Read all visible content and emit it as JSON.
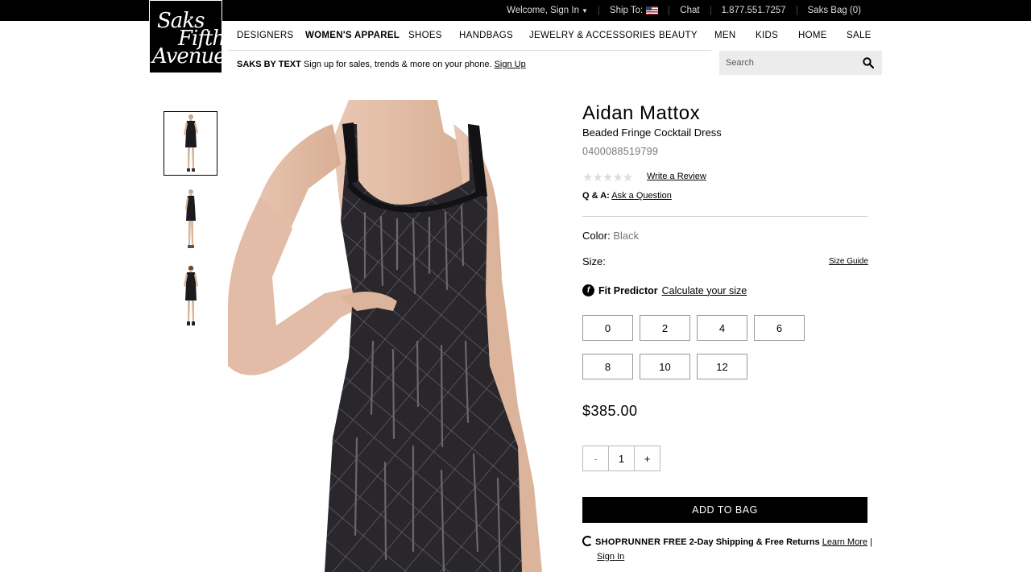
{
  "topbar": {
    "welcome": "Welcome, Sign In",
    "ship_to": "Ship To:",
    "chat": "Chat",
    "phone": "1.877.551.7257",
    "bag": "Saks Bag (0)"
  },
  "logo": {
    "line1": "Saks",
    "line2": "Fifth",
    "line3": "Avenue"
  },
  "nav": {
    "items": [
      {
        "label": "DESIGNERS"
      },
      {
        "label": "WOMEN'S APPAREL"
      },
      {
        "label": "SHOES"
      },
      {
        "label": "HANDBAGS"
      },
      {
        "label": "JEWELRY & ACCESSORIES"
      },
      {
        "label": "BEAUTY"
      },
      {
        "label": "MEN"
      },
      {
        "label": "KIDS"
      },
      {
        "label": "HOME"
      },
      {
        "label": "SALE"
      }
    ]
  },
  "promo": {
    "title": "SAKS BY TEXT",
    "text": "Sign up for sales, trends & more on your phone.",
    "link": "Sign Up"
  },
  "search": {
    "placeholder": "Search"
  },
  "product": {
    "brand": "Aidan Mattox",
    "name": "Beaded Fringe Cocktail Dress",
    "sku": "0400088519799",
    "rating_stars": "★★★★★",
    "write_review": "Write a Review",
    "qa_label": "Q & A:",
    "ask_question": "Ask a Question",
    "color_label": "Color:",
    "color_value": "Black",
    "size_label": "Size:",
    "size_guide": "Size Guide",
    "fit_icon": "f",
    "fit_label": "Fit Predictor",
    "fit_link": "Calculate your size",
    "sizes": [
      "0",
      "2",
      "4",
      "6",
      "8",
      "10",
      "12"
    ],
    "price": "$385.00",
    "qty_minus": "-",
    "qty_value": "1",
    "qty_plus": "+",
    "add_to_bag": "ADD TO BAG",
    "shoprunner_logo": "SHOPRUNNER",
    "shoprunner_free": "FREE 2-Day Shipping & Free Returns",
    "learn_more": "Learn More",
    "separator": "|",
    "sign_in": "Sign In"
  },
  "colors": {
    "accent": "#000000",
    "topbar_bg": "#000000",
    "search_bg": "#ececec",
    "muted": "#777777"
  }
}
